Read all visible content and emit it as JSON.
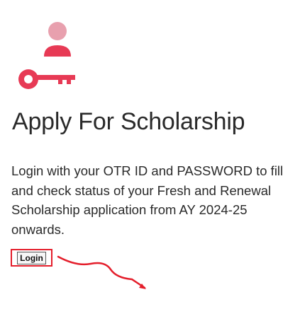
{
  "logo": {
    "icon": "user-key-icon",
    "color": "#e73a55"
  },
  "page_title": "Apply For Scholarship",
  "description": "Login with your OTR ID and PASSWORD to fill and check status of your Fresh and Renewal Scholarship application from AY 2024-25 onwards.",
  "login_button": {
    "label": "Login"
  },
  "annotation": {
    "highlight_color": "#e41e2b",
    "arrow_icon": "arrow-pointing-left-icon"
  }
}
